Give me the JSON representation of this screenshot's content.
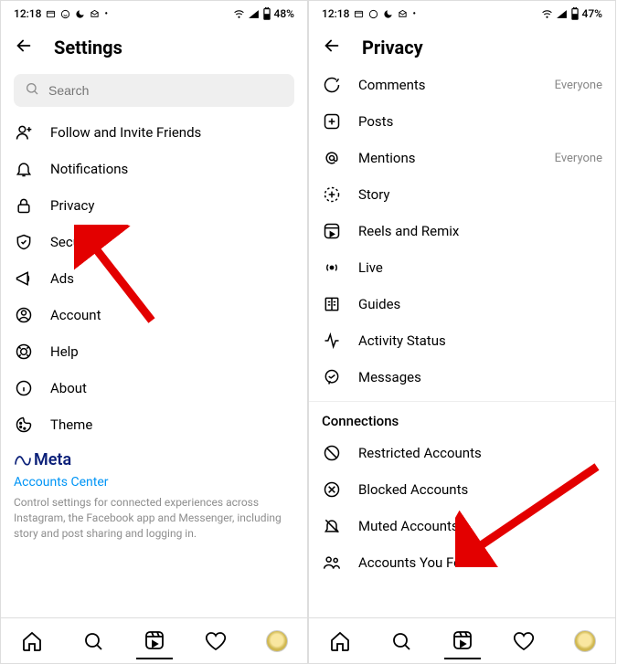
{
  "screen1": {
    "status": {
      "time": "12:18",
      "battery": "48%"
    },
    "title": "Settings",
    "search_placeholder": "Search",
    "items": [
      {
        "icon": "follow-invite-icon",
        "label": "Follow and Invite Friends"
      },
      {
        "icon": "notifications-icon",
        "label": "Notifications"
      },
      {
        "icon": "privacy-icon",
        "label": "Privacy"
      },
      {
        "icon": "security-icon",
        "label": "Security"
      },
      {
        "icon": "ads-icon",
        "label": "Ads"
      },
      {
        "icon": "account-icon",
        "label": "Account"
      },
      {
        "icon": "help-icon",
        "label": "Help"
      },
      {
        "icon": "about-icon",
        "label": "About"
      },
      {
        "icon": "theme-icon",
        "label": "Theme"
      }
    ],
    "meta_brand": "Meta",
    "accounts_center": "Accounts Center",
    "meta_description": "Control settings for connected experiences across Instagram, the Facebook app and Messenger, including story and post sharing and logging in."
  },
  "screen2": {
    "status": {
      "time": "12:18",
      "battery": "47%"
    },
    "title": "Privacy",
    "items": [
      {
        "icon": "comments-icon",
        "label": "Comments",
        "trail": "Everyone"
      },
      {
        "icon": "posts-icon",
        "label": "Posts"
      },
      {
        "icon": "mentions-icon",
        "label": "Mentions",
        "trail": "Everyone"
      },
      {
        "icon": "story-icon",
        "label": "Story"
      },
      {
        "icon": "reels-remix-icon",
        "label": "Reels and Remix"
      },
      {
        "icon": "live-icon",
        "label": "Live"
      },
      {
        "icon": "guides-icon",
        "label": "Guides"
      },
      {
        "icon": "activity-status-icon",
        "label": "Activity Status"
      },
      {
        "icon": "messages-icon",
        "label": "Messages"
      }
    ],
    "section": "Connections",
    "conn_items": [
      {
        "icon": "restricted-icon",
        "label": "Restricted Accounts"
      },
      {
        "icon": "blocked-icon",
        "label": "Blocked Accounts"
      },
      {
        "icon": "muted-icon",
        "label": "Muted Accounts"
      },
      {
        "icon": "follow-icon",
        "label": "Accounts You Follow"
      }
    ]
  }
}
